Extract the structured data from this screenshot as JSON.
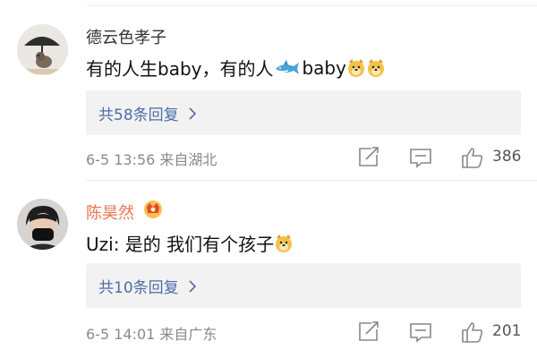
{
  "comments": [
    {
      "username": "德云色孝子",
      "text_parts": [
        "有的人生baby，有的人",
        "baby"
      ],
      "emoji": [
        "doge-icon",
        "shark-icon"
      ],
      "reply_link": "共58条回复",
      "timestamp": "6-5 13:56",
      "location": "来自湖北",
      "like_count": "386"
    },
    {
      "username": "陈昊然",
      "text": "Uzi: 是的 我们有个孩子",
      "reply_link": "共10条回复",
      "timestamp": "6-5 14:01",
      "location": "来自广东",
      "like_count": "201"
    }
  ],
  "colors": {
    "link": "#4c6ea8",
    "vip_name": "#eb7350",
    "meta": "#8a8a8a",
    "reply_bg": "#f2f2f2"
  }
}
